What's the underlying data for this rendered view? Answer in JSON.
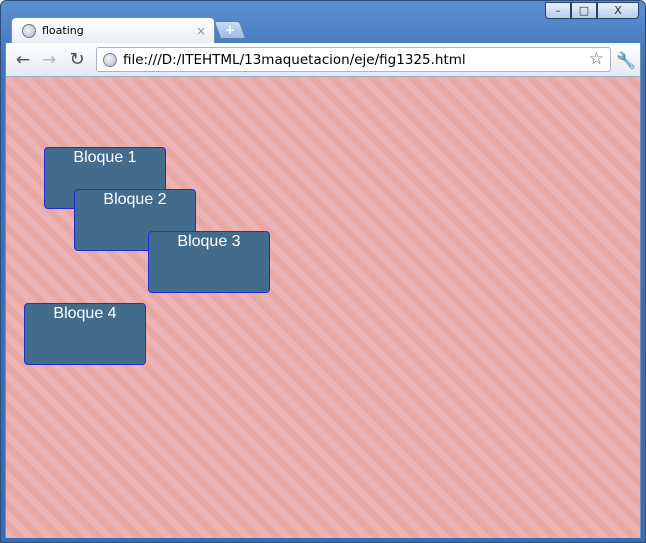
{
  "browser": {
    "tab": {
      "title": "floating",
      "close_glyph": "×"
    },
    "new_tab_glyph": "+",
    "toolbar": {
      "back_glyph": "←",
      "forward_glyph": "→",
      "reload_glyph": "↻",
      "url": "file:///D:/ITEHTML/13maquetacion/eje/fig1325.html",
      "star_glyph": "☆",
      "wrench_glyph": "🔧"
    },
    "window_controls": {
      "minimize": "–",
      "maximize": "□",
      "close": "X"
    }
  },
  "page": {
    "blocks": [
      {
        "label": "Bloque 1"
      },
      {
        "label": "Bloque 2"
      },
      {
        "label": "Bloque 3"
      },
      {
        "label": "Bloque 4"
      }
    ]
  },
  "colors": {
    "block_fill": "#436c8c",
    "block_border": "#1a31d8",
    "stripe_light": "#ecb3b7",
    "stripe_dark": "#e9a8a4"
  }
}
